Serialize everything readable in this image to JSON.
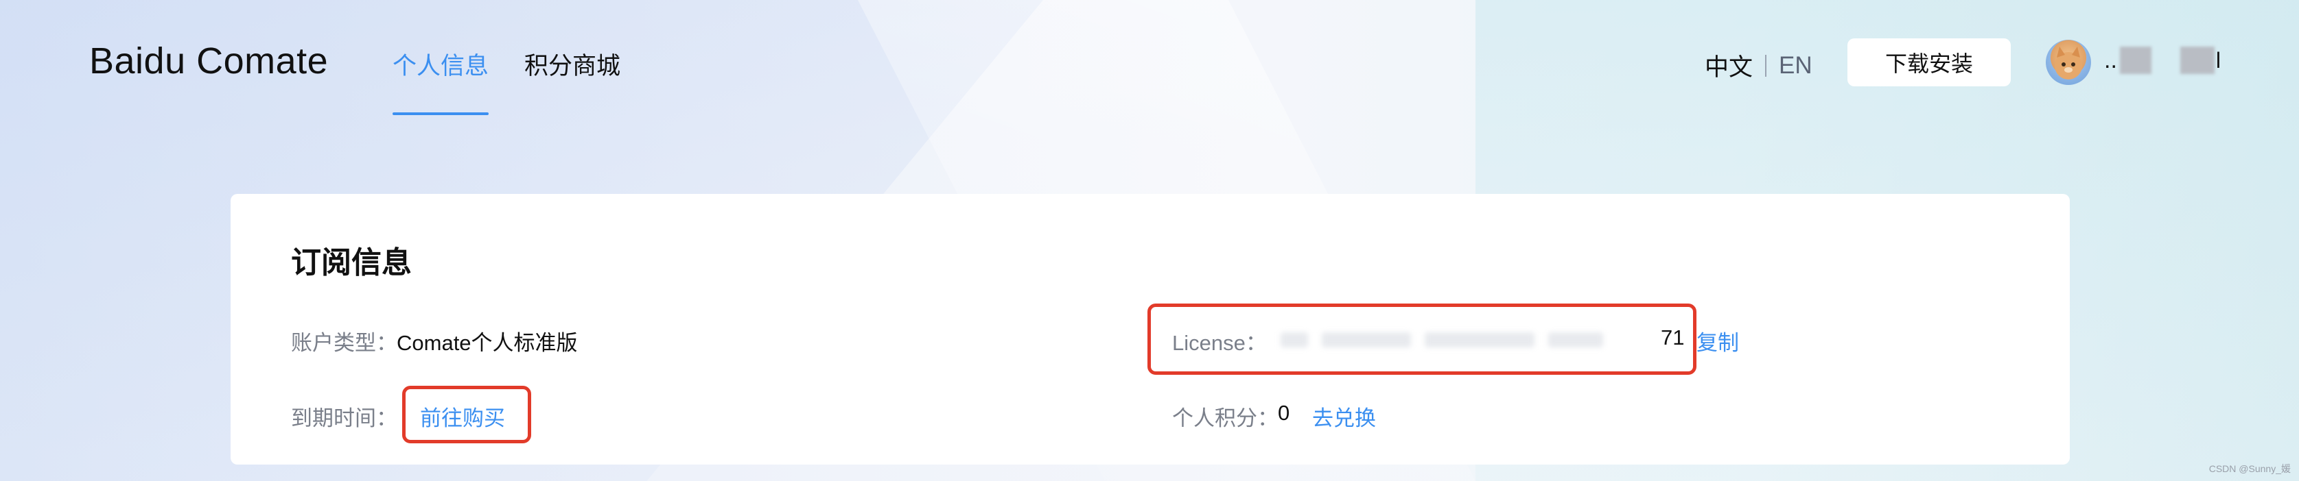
{
  "header": {
    "logo": "Baidu Comate",
    "tabs": [
      {
        "label": "个人信息",
        "active": true
      },
      {
        "label": "积分商城",
        "active": false
      }
    ],
    "lang": {
      "zh": "中文",
      "en": "EN"
    },
    "download_label": "下载安装",
    "username_visible": ".."
  },
  "subscription": {
    "title": "订阅信息",
    "account_type_label": "账户类型：",
    "account_type_value": "Comate个人标准版",
    "expire_label": "到期时间：",
    "expire_action": "前往购买",
    "license_label": "License：",
    "license_suffix": "71",
    "copy_label": "复制",
    "points_label": "个人积分：",
    "points_value": "0",
    "redeem_label": "去兑换"
  },
  "colors": {
    "accent": "#3b8ff0",
    "highlight_box": "#e23b2a"
  },
  "watermark": "CSDN @Sunny_媛"
}
